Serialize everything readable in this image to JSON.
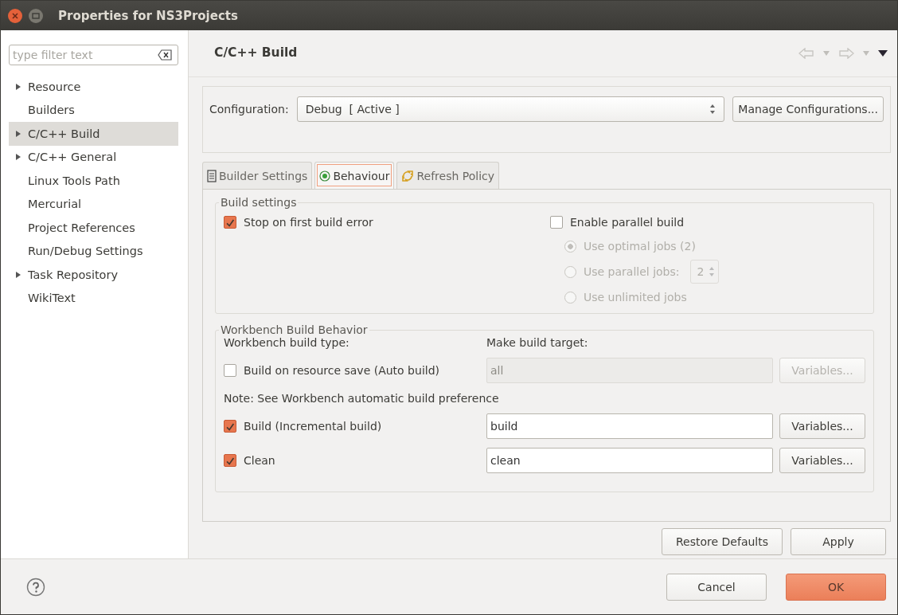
{
  "window": {
    "title": "Properties for NS3Projects"
  },
  "filter": {
    "placeholder": "type filter text"
  },
  "tree": [
    {
      "label": "Resource",
      "expandable": true,
      "selected": false
    },
    {
      "label": "Builders",
      "expandable": false,
      "selected": false
    },
    {
      "label": "C/C++ Build",
      "expandable": true,
      "selected": true
    },
    {
      "label": "C/C++ General",
      "expandable": true,
      "selected": false
    },
    {
      "label": "Linux Tools Path",
      "expandable": false,
      "selected": false
    },
    {
      "label": "Mercurial",
      "expandable": false,
      "selected": false
    },
    {
      "label": "Project References",
      "expandable": false,
      "selected": false
    },
    {
      "label": "Run/Debug Settings",
      "expandable": false,
      "selected": false
    },
    {
      "label": "Task Repository",
      "expandable": true,
      "selected": false
    },
    {
      "label": "WikiText",
      "expandable": false,
      "selected": false
    }
  ],
  "page": {
    "title": "C/C++ Build"
  },
  "configuration": {
    "label": "Configuration:",
    "value": "Debug  [ Active ]",
    "button": "Manage Configurations..."
  },
  "tabs": [
    {
      "label": "Builder Settings",
      "kind": "list",
      "selected": false
    },
    {
      "label": "Behaviour",
      "kind": "radio",
      "selected": true
    },
    {
      "label": "Refresh Policy",
      "kind": "refresh",
      "selected": false
    }
  ],
  "build_settings": {
    "title": "Build settings",
    "stop_on_error": {
      "label": "Stop on first build error",
      "checked": true
    },
    "parallel": {
      "label": "Enable parallel build",
      "checked": false
    },
    "jobs": [
      {
        "label": "Use optimal jobs (2)",
        "selected": true,
        "disabled": true
      },
      {
        "label": "Use parallel jobs:",
        "selected": false,
        "disabled": true,
        "spinner": "2"
      },
      {
        "label": "Use unlimited jobs",
        "selected": false,
        "disabled": true
      }
    ]
  },
  "workbench": {
    "title": "Workbench Build Behavior",
    "type_label": "Workbench build type:",
    "target_label": "Make build target:",
    "auto": {
      "label": "Build on resource save (Auto build)",
      "checked": false,
      "value": "all",
      "button": "Variables..."
    },
    "note": "Note: See Workbench automatic build preference",
    "rows": [
      {
        "label": "Build (Incremental build)",
        "checked": true,
        "value": "build",
        "button": "Variables..."
      },
      {
        "label": "Clean",
        "checked": true,
        "value": "clean",
        "button": "Variables..."
      }
    ]
  },
  "buttons": {
    "restore": "Restore Defaults",
    "apply": "Apply",
    "cancel": "Cancel",
    "ok": "OK"
  }
}
